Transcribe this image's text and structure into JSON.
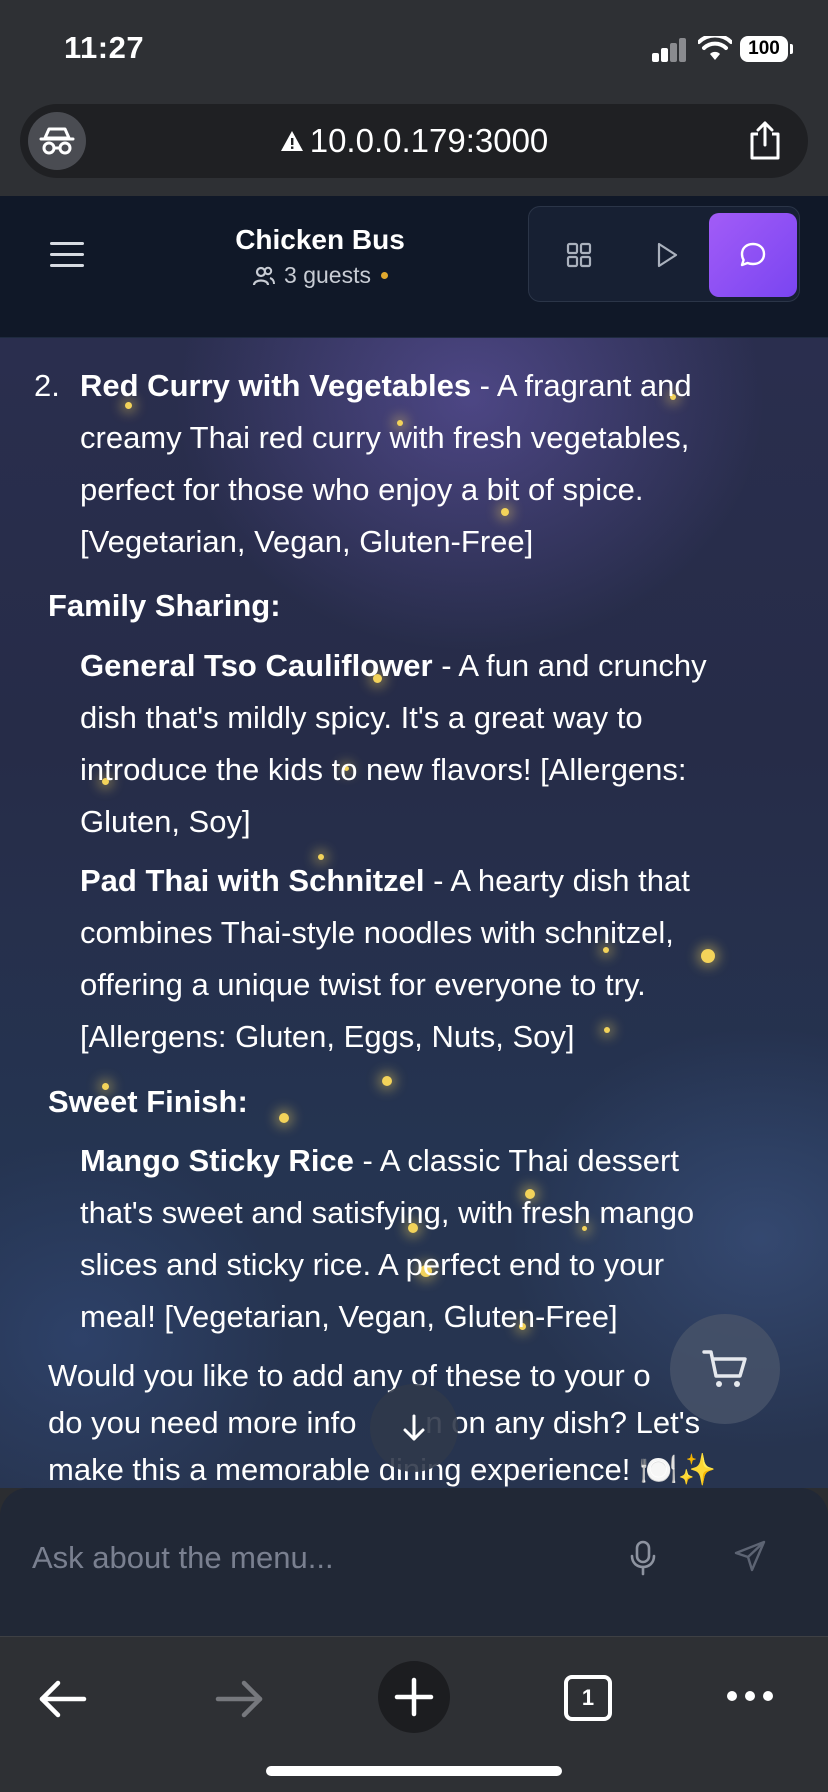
{
  "status_bar": {
    "time": "11:27",
    "battery": "100"
  },
  "browser": {
    "url": "10.0.0.179:3000",
    "tab_count": "1"
  },
  "header": {
    "title": "Chicken Bus",
    "guests": "3 guests"
  },
  "chat": {
    "item2_number": "2.",
    "item2_name": "Red Curry with Vegetables",
    "item2_desc_l1": " - A fragrant and",
    "item2_desc_l2": "creamy Thai red curry with fresh vegetables,",
    "item2_desc_l3": "perfect for those who enjoy a bit of spice.",
    "item2_desc_l4": "[Vegetarian, Vegan, Gluten-Free]",
    "section_family": "Family Sharing:",
    "dish1_name": "General Tso Cauliflower",
    "dish1_l1": " - A fun and crunchy",
    "dish1_l2": "dish that's mildly spicy. It's a great way to",
    "dish1_l3": "introduce the kids to new flavors! [Allergens:",
    "dish1_l4": "Gluten, Soy]",
    "dish2_name": "Pad Thai with Schnitzel",
    "dish2_l1": " - A hearty dish that",
    "dish2_l2": "combines Thai-style noodles with schnitzel,",
    "dish2_l3": "offering a unique twist for everyone to try.",
    "dish2_l4": "[Allergens: Gluten, Eggs, Nuts, Soy]",
    "section_sweet": "Sweet Finish:",
    "dish3_name": "Mango Sticky Rice",
    "dish3_l1": " - A classic Thai dessert",
    "dish3_l2": "that's sweet and satisfying, with fresh mango",
    "dish3_l3": "slices and sticky rice. A perfect end to your",
    "dish3_l4": "meal! [Vegetarian, Vegan, Gluten-Free]",
    "closing_l1": "Would you like to add any of these to your o",
    "closing_l2": "do you need more info        n on any dish? Let's",
    "closing_l3": "make this a memorable dining experience! 🍽️✨"
  },
  "input": {
    "placeholder": "Ask about the menu..."
  },
  "colors": {
    "header_bg": "#101828",
    "accent_purple": "#9b59f6",
    "guest_dot": "#e0a82e",
    "chat_bg": "#262c48"
  },
  "icons": {
    "incognito": "incognito-icon",
    "warning": "warning-icon",
    "share": "share-icon",
    "menu": "hamburger-icon",
    "guests": "users-icon",
    "grid": "grid-icon",
    "play": "play-icon",
    "chat": "chat-bubble-icon",
    "cart": "cart-icon",
    "scroll_down": "arrow-down-icon",
    "mic": "microphone-icon",
    "send": "send-icon",
    "back": "arrow-left-icon",
    "forward": "arrow-right-icon",
    "new_tab": "plus-icon",
    "more": "more-dots-icon"
  }
}
